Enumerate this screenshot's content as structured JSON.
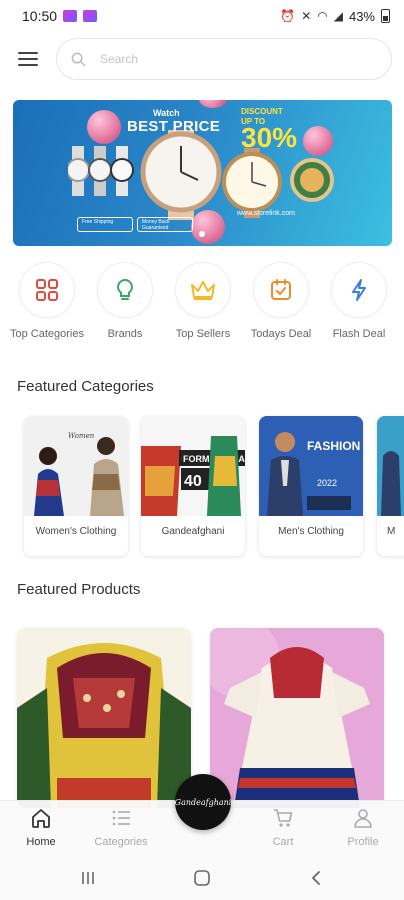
{
  "status_bar": {
    "time": "10:50",
    "battery": "43%"
  },
  "search": {
    "placeholder": "Search"
  },
  "banner": {
    "watch_label": "Watch",
    "title": "BEST PRICE",
    "discount_label": "DISCOUNT",
    "upto_label": "UP TO",
    "discount_value": "30%",
    "url": "www.storelink.com",
    "tag_1": "Free Shipping",
    "tag_2": "Money Back Guaranteed"
  },
  "quick_categories": [
    {
      "label": "Top Categories",
      "icon": "grid-icon"
    },
    {
      "label": "Brands",
      "icon": "bulb-icon"
    },
    {
      "label": "Top Sellers",
      "icon": "crown-icon"
    },
    {
      "label": "Todays Deal",
      "icon": "calendar-check-icon"
    },
    {
      "label": "Flash Deal",
      "icon": "lightning-icon"
    }
  ],
  "featured_categories": {
    "title": "Featured Categories",
    "items": [
      {
        "label": "Women's Clothing"
      },
      {
        "label": "Gandeafghani"
      },
      {
        "label": "Men's Clothing"
      },
      {
        "label": "M"
      }
    ],
    "banner_text_1": "FORMAL WEAR",
    "banner_number": "40",
    "banner_text_2": "FASHION TREND",
    "banner_year": "2022"
  },
  "featured_products": {
    "title": "Featured Products"
  },
  "bottom_nav": {
    "items": [
      {
        "label": "Home",
        "icon": "home-icon"
      },
      {
        "label": "Categories",
        "icon": "list-icon"
      },
      {
        "label": "Cart",
        "icon": "cart-icon"
      },
      {
        "label": "Profile",
        "icon": "profile-icon"
      }
    ],
    "center_logo": "Gandeafghani"
  },
  "colors": {
    "accent_red": "#e14b3b",
    "accent_green": "#3aa660",
    "accent_yellow": "#f2b928",
    "accent_orange": "#f08a2a",
    "accent_blue": "#3a7ee0"
  }
}
